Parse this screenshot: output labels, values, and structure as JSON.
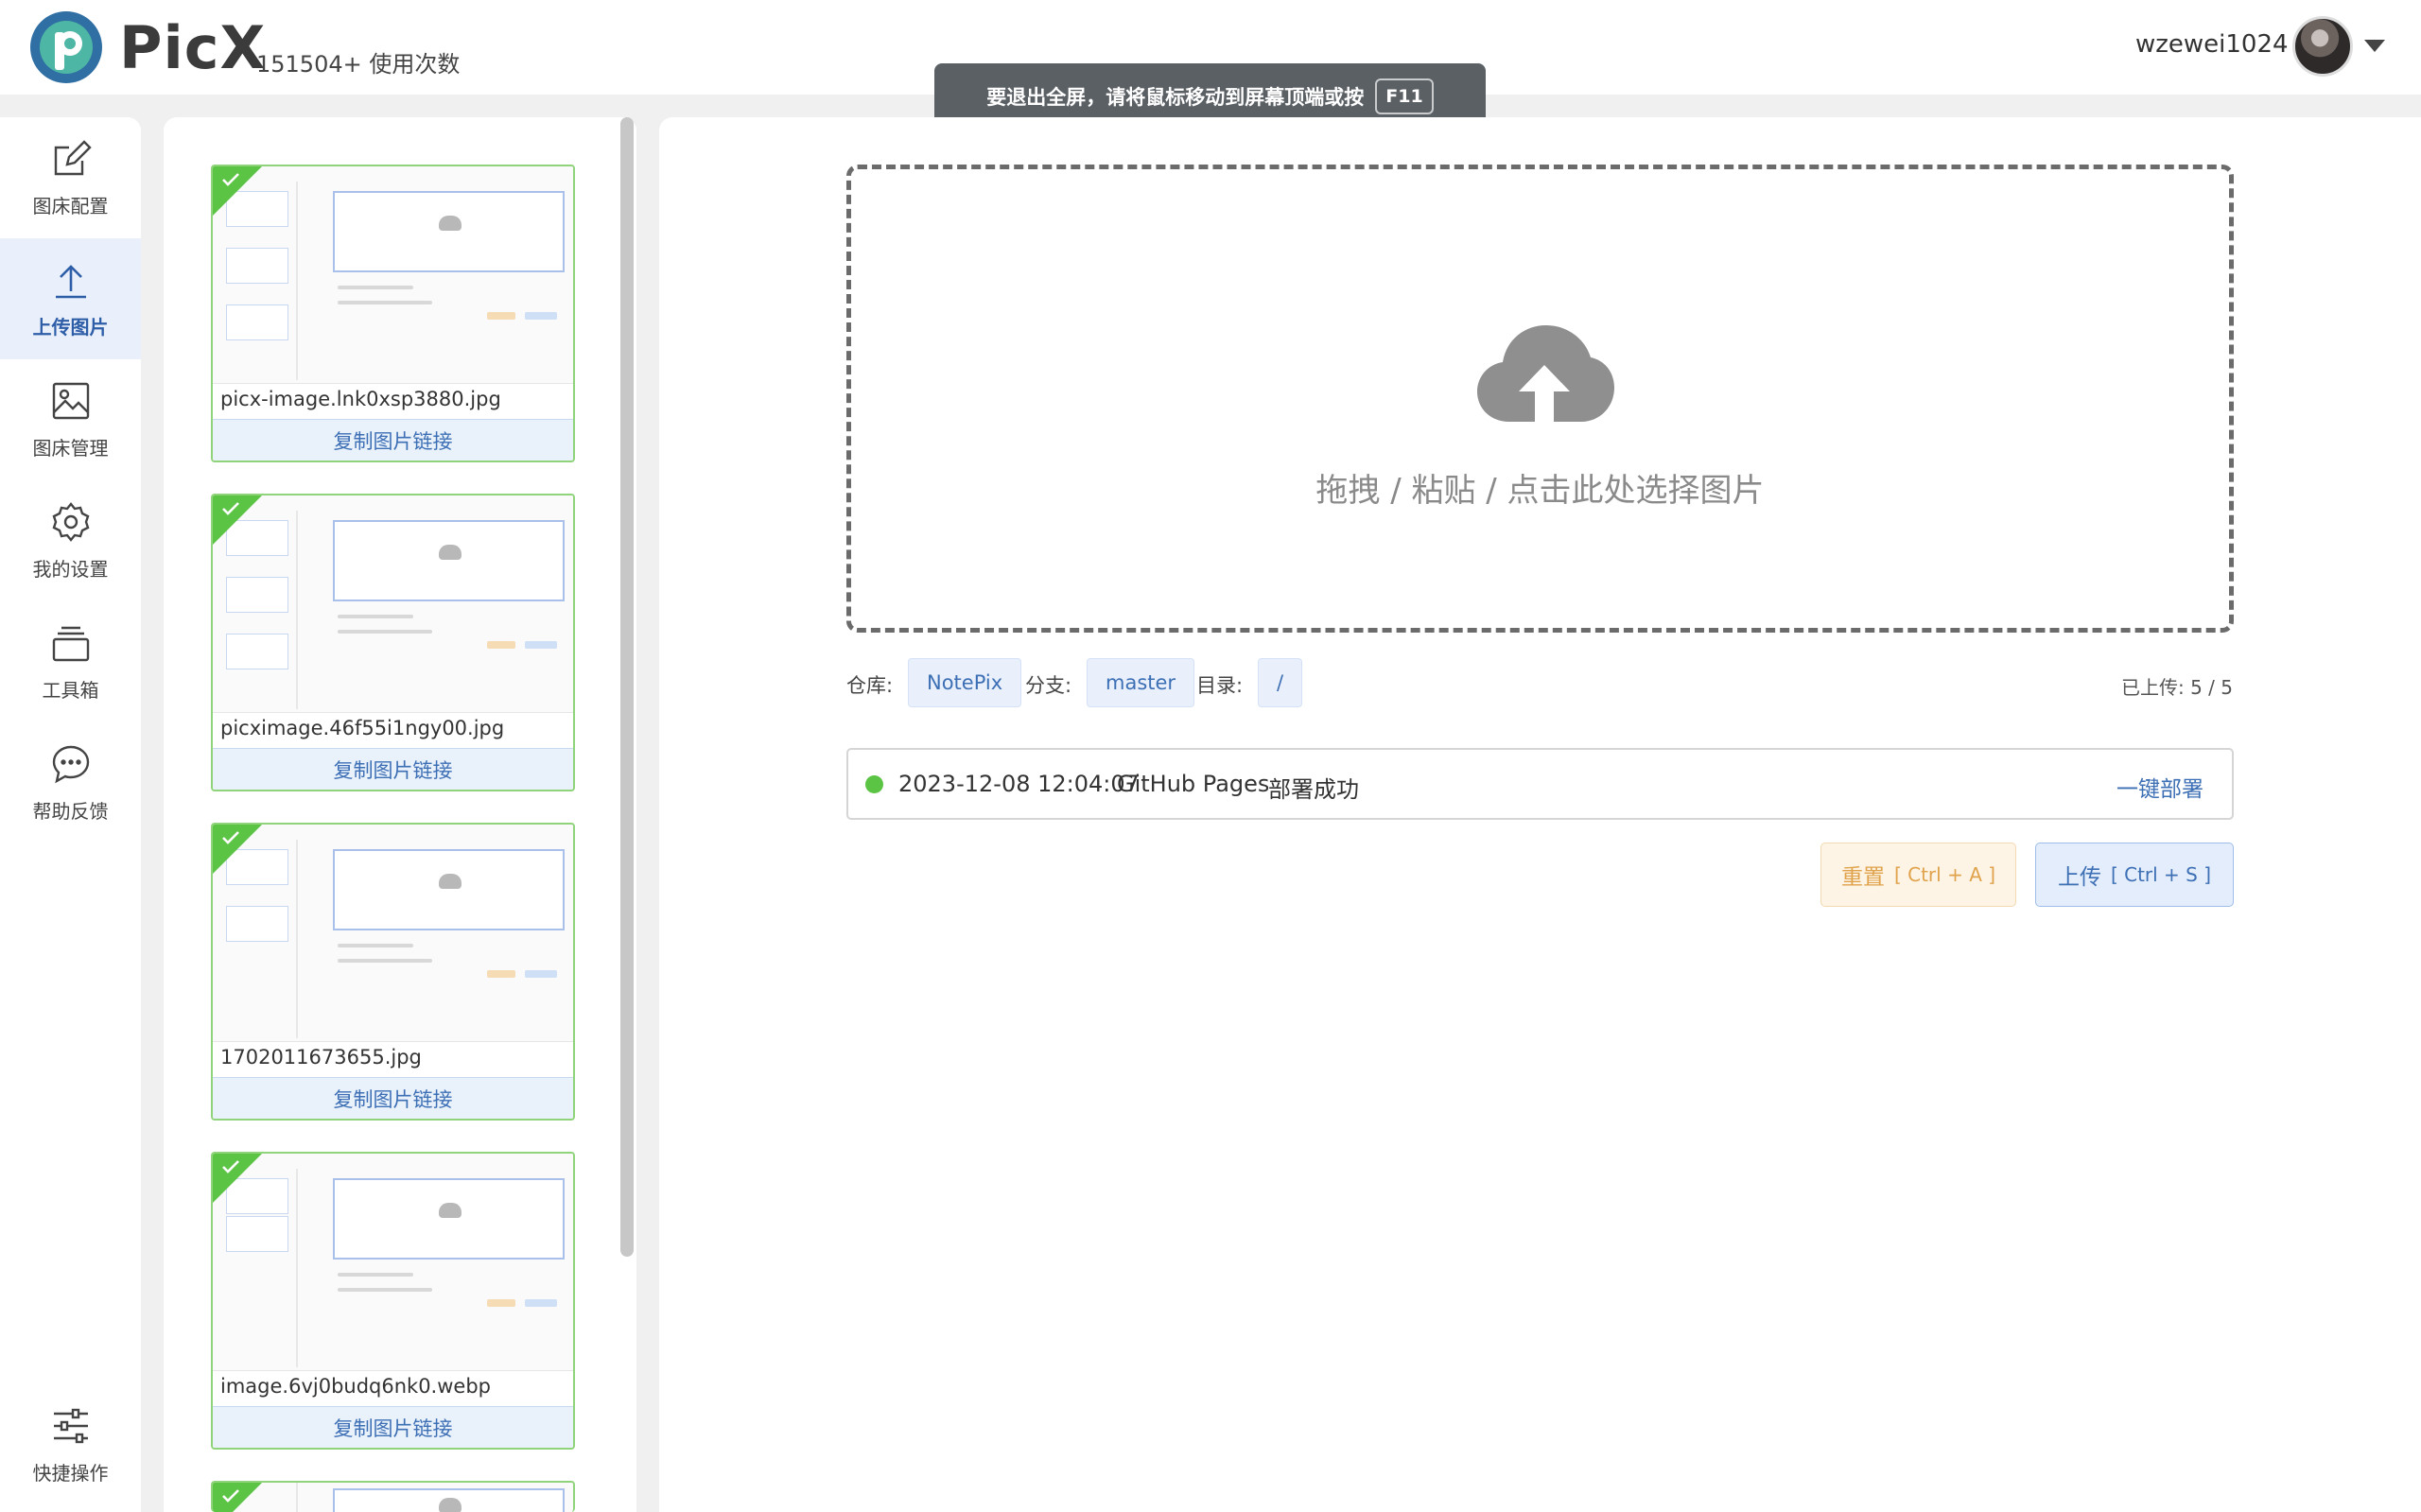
{
  "app": {
    "brand": "PicX",
    "usage": "151504+ 使用次数"
  },
  "user": {
    "name": "wzewei1024"
  },
  "fullscreen_toast": {
    "text": "要退出全屏，请将鼠标移动到屏幕顶端或按",
    "key": "F11"
  },
  "nav": {
    "items": [
      {
        "label": "图床配置",
        "icon": "edit-icon"
      },
      {
        "label": "上传图片",
        "icon": "upload-icon",
        "active": true
      },
      {
        "label": "图床管理",
        "icon": "image-icon"
      },
      {
        "label": "我的设置",
        "icon": "gear-icon"
      },
      {
        "label": "工具箱",
        "icon": "layers-icon"
      },
      {
        "label": "帮助反馈",
        "icon": "chat-icon"
      }
    ],
    "bottom": {
      "label": "快捷操作",
      "icon": "sliders-icon"
    }
  },
  "uploaded": {
    "items": [
      {
        "filename": "picx-image.lnk0xsp3880.jpg",
        "copy_label": "复制图片链接"
      },
      {
        "filename": "picximage.46f55i1ngy00.jpg",
        "copy_label": "复制图片链接"
      },
      {
        "filename": "1702011673655.jpg",
        "copy_label": "复制图片链接"
      },
      {
        "filename": "image.6vj0budq6nk0.webp",
        "copy_label": "复制图片链接"
      }
    ]
  },
  "dropzone": {
    "text": "拖拽 / 粘贴 / 点击此处选择图片",
    "icon": "cloud-upload-icon"
  },
  "meta": {
    "repo_label": "仓库:",
    "repo": "NotePix",
    "branch_label": "分支:",
    "branch": "master",
    "dir_label": "目录:",
    "dir": "/",
    "uploaded_count": "已上传: 5 / 5"
  },
  "deploy": {
    "time": "2023-12-08 12:04:07",
    "service": "GitHub Pages",
    "result": "部署成功",
    "action": "一键部署",
    "status_color": "#5cc444"
  },
  "actions": {
    "reset_label": "重置",
    "reset_shortcut": "[ Ctrl + A ]",
    "upload_label": "上传",
    "upload_shortcut": "[ Ctrl + S ]"
  }
}
